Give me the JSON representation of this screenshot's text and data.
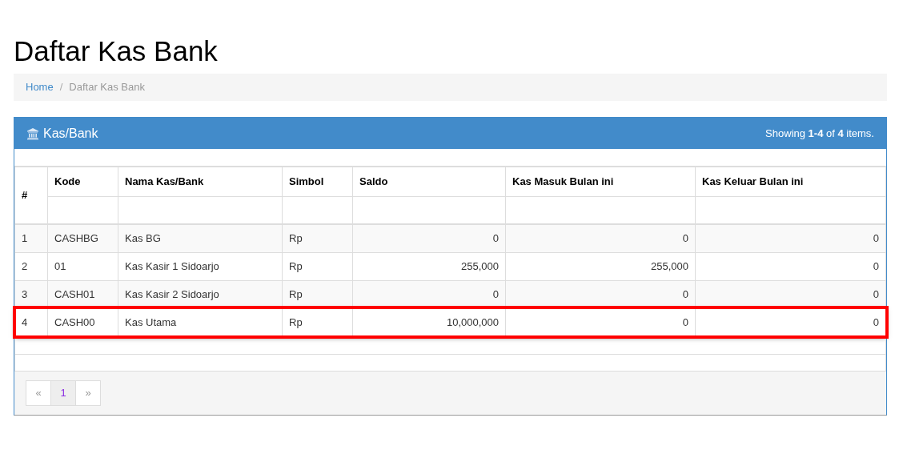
{
  "page_title": "Daftar Kas Bank",
  "breadcrumb": [
    {
      "label": "Home",
      "kind": "link"
    },
    {
      "label": "/",
      "kind": "separator"
    },
    {
      "label": "Daftar Kas Bank",
      "kind": "current"
    }
  ],
  "panel": {
    "title": "Kas/Bank",
    "summary": "Showing **1-4** of **4** items."
  },
  "table": {
    "columns": [
      {
        "label": "#",
        "kind": "text"
      },
      {
        "label": "Kode",
        "kind": "text"
      },
      {
        "label": "Nama Kas/Bank",
        "kind": "text"
      },
      {
        "label": "Simbol",
        "kind": "text"
      },
      {
        "label": "Saldo",
        "kind": "number"
      },
      {
        "label": "Kas Masuk Bulan ini",
        "kind": "number"
      },
      {
        "label": "Kas Keluar Bulan ini",
        "kind": "number"
      }
    ],
    "rows": [
      {
        "cells": [
          "1",
          "CASHBG",
          "Kas BG",
          "Rp",
          "0",
          "0",
          "0"
        ],
        "highlighted": false
      },
      {
        "cells": [
          "2",
          "01",
          "Kas Kasir 1 Sidoarjo",
          "Rp",
          "255,000",
          "255,000",
          "0"
        ],
        "highlighted": false
      },
      {
        "cells": [
          "3",
          "CASH01",
          "Kas Kasir 2 Sidoarjo",
          "Rp",
          "0",
          "0",
          "0"
        ],
        "highlighted": false
      },
      {
        "cells": [
          "4",
          "CASH00",
          "Kas Utama",
          "Rp",
          "10,000,000",
          "0",
          "0"
        ],
        "highlighted": true
      }
    ]
  },
  "pagination": [
    {
      "label": "«",
      "disabled": true,
      "selected": false
    },
    {
      "label": "1",
      "disabled": false,
      "selected": true
    },
    {
      "label": "»",
      "disabled": true,
      "selected": false
    }
  ]
}
